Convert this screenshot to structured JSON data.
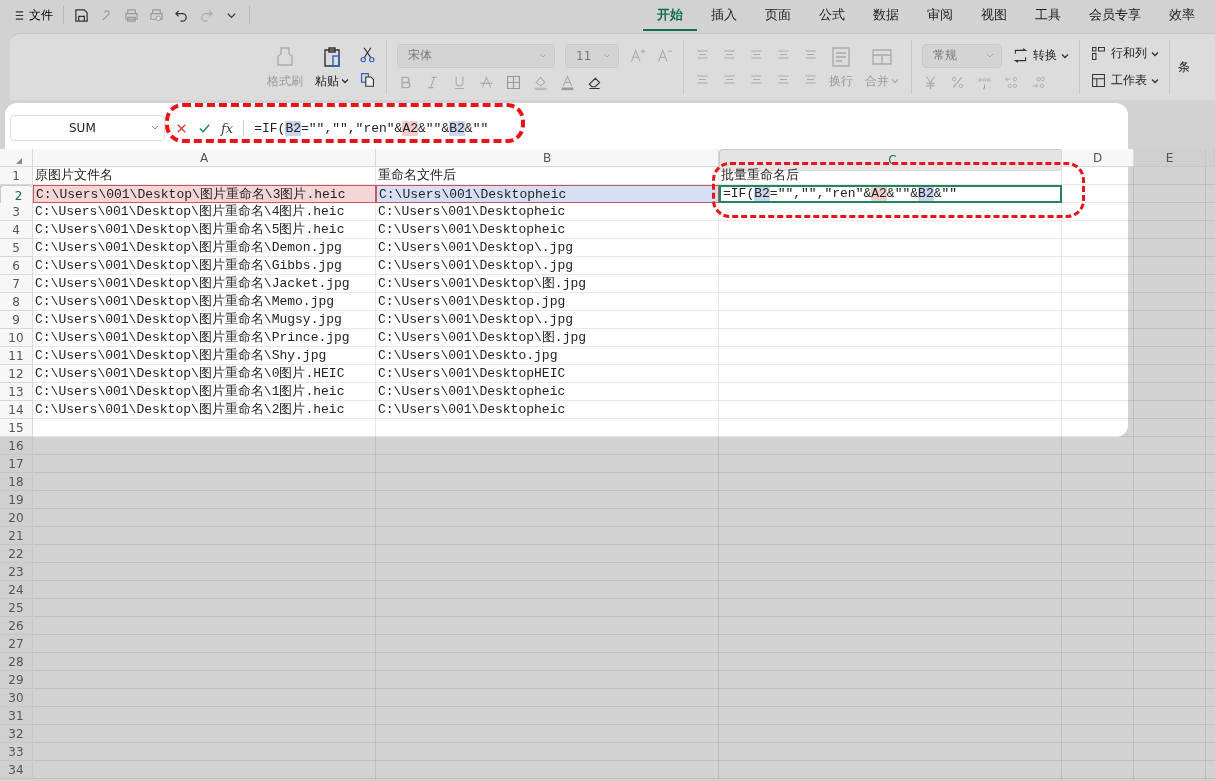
{
  "title_bar": {
    "menu_label": "文件",
    "tabs": [
      {
        "label": "开始",
        "selected": true
      },
      {
        "label": "插入",
        "selected": false
      },
      {
        "label": "页面",
        "selected": false
      },
      {
        "label": "公式",
        "selected": false
      },
      {
        "label": "数据",
        "selected": false
      },
      {
        "label": "审阅",
        "selected": false
      },
      {
        "label": "视图",
        "selected": false
      },
      {
        "label": "工具",
        "selected": false
      },
      {
        "label": "会员专享",
        "selected": false
      },
      {
        "label": "效率",
        "selected": false
      }
    ]
  },
  "ribbon": {
    "format_painter": "格式刷",
    "paste": "粘贴",
    "font": "宋体",
    "font_size": "11",
    "wrap": "换行",
    "merge": "合并",
    "number_format": "常规",
    "convert": "转换",
    "rows_cols": "行和列",
    "worksheet": "工作表",
    "cut_off": "条"
  },
  "formula_bar": {
    "name_box": "SUM",
    "fx": "fx",
    "formula": [
      {
        "kind": "plain",
        "text": "=IF("
      },
      {
        "kind": "ref",
        "text": "B2",
        "color": "#c9d5ef"
      },
      {
        "kind": "plain",
        "text": "=\"\",\"\",\"ren\"&"
      },
      {
        "kind": "ref",
        "text": "A2",
        "color": "#f0cccc"
      },
      {
        "kind": "plain",
        "text": "&\"\"&"
      },
      {
        "kind": "ref",
        "text": "B2",
        "color": "#c9d5ef"
      },
      {
        "kind": "plain",
        "text": "&\"\""
      }
    ]
  },
  "sheet": {
    "columns": [
      {
        "label": "A",
        "selected": false
      },
      {
        "label": "B",
        "selected": false
      },
      {
        "label": "C",
        "selected": true
      },
      {
        "label": "D",
        "selected": false
      },
      {
        "label": "E",
        "selected": false
      }
    ],
    "rows": [
      {
        "num": "1",
        "selected": false,
        "cells": [
          {
            "text": "原图片文件名"
          },
          {
            "text": "重命名文件后"
          },
          {
            "text": "批量重命名后"
          }
        ]
      },
      {
        "num": "2",
        "selected": true,
        "cells": [
          {
            "text": "C:\\Users\\001\\Desktop\\图片重命名\\3图片.heic",
            "color": "#f5d6d6"
          },
          {
            "text": "C:\\Users\\001\\Desktopheic",
            "color": "#d6dff3"
          },
          {
            "formula": [
              {
                "kind": "plain",
                "text": "=IF("
              },
              {
                "kind": "ref",
                "text": "B2",
                "color": "#c9d5ef"
              },
              {
                "kind": "plain",
                "text": "=\"\",\"\",\"ren\"&"
              },
              {
                "kind": "ref",
                "text": "A2",
                "color": "#f0cccc"
              },
              {
                "kind": "plain",
                "text": "&\"\"&"
              },
              {
                "kind": "ref",
                "text": "B2",
                "color": "#c9d5ef"
              },
              {
                "kind": "plain",
                "text": "&\"\""
              }
            ]
          }
        ]
      },
      {
        "num": "3",
        "selected": false,
        "cells": [
          {
            "text": "C:\\Users\\001\\Desktop\\图片重命名\\4图片.heic"
          },
          {
            "text": "C:\\Users\\001\\Desktopheic"
          }
        ]
      },
      {
        "num": "4",
        "selected": false,
        "cells": [
          {
            "text": "C:\\Users\\001\\Desktop\\图片重命名\\5图片.heic"
          },
          {
            "text": "C:\\Users\\001\\Desktopheic"
          }
        ]
      },
      {
        "num": "5",
        "selected": false,
        "cells": [
          {
            "text": "C:\\Users\\001\\Desktop\\图片重命名\\Demon.jpg"
          },
          {
            "text": "C:\\Users\\001\\Desktop\\.jpg"
          }
        ]
      },
      {
        "num": "6",
        "selected": false,
        "cells": [
          {
            "text": "C:\\Users\\001\\Desktop\\图片重命名\\Gibbs.jpg"
          },
          {
            "text": "C:\\Users\\001\\Desktop\\.jpg"
          }
        ]
      },
      {
        "num": "7",
        "selected": false,
        "cells": [
          {
            "text": "C:\\Users\\001\\Desktop\\图片重命名\\Jacket.jpg"
          },
          {
            "text": "C:\\Users\\001\\Desktop\\图.jpg"
          }
        ]
      },
      {
        "num": "8",
        "selected": false,
        "cells": [
          {
            "text": "C:\\Users\\001\\Desktop\\图片重命名\\Memo.jpg"
          },
          {
            "text": "C:\\Users\\001\\Desktop.jpg"
          }
        ]
      },
      {
        "num": "9",
        "selected": false,
        "cells": [
          {
            "text": "C:\\Users\\001\\Desktop\\图片重命名\\Mugsy.jpg"
          },
          {
            "text": "C:\\Users\\001\\Desktop\\.jpg"
          }
        ]
      },
      {
        "num": "10",
        "selected": false,
        "cells": [
          {
            "text": "C:\\Users\\001\\Desktop\\图片重命名\\Prince.jpg"
          },
          {
            "text": "C:\\Users\\001\\Desktop\\图.jpg"
          }
        ]
      },
      {
        "num": "11",
        "selected": false,
        "cells": [
          {
            "text": "C:\\Users\\001\\Desktop\\图片重命名\\Shy.jpg"
          },
          {
            "text": "C:\\Users\\001\\Deskto.jpg"
          }
        ]
      },
      {
        "num": "12",
        "selected": false,
        "cells": [
          {
            "text": "C:\\Users\\001\\Desktop\\图片重命名\\0图片.HEIC"
          },
          {
            "text": "C:\\Users\\001\\DesktopHEIC"
          }
        ]
      },
      {
        "num": "13",
        "selected": false,
        "cells": [
          {
            "text": "C:\\Users\\001\\Desktop\\图片重命名\\1图片.heic"
          },
          {
            "text": "C:\\Users\\001\\Desktopheic"
          }
        ]
      },
      {
        "num": "14",
        "selected": false,
        "cells": [
          {
            "text": "C:\\Users\\001\\Desktop\\图片重命名\\2图片.heic"
          },
          {
            "text": "C:\\Users\\001\\Desktopheic"
          }
        ]
      }
    ],
    "empty_rows": [
      "15",
      "16",
      "17",
      "18",
      "19",
      "20",
      "21",
      "22",
      "23",
      "24",
      "25",
      "26",
      "27",
      "28",
      "29",
      "30",
      "31",
      "32",
      "33",
      "34"
    ]
  }
}
